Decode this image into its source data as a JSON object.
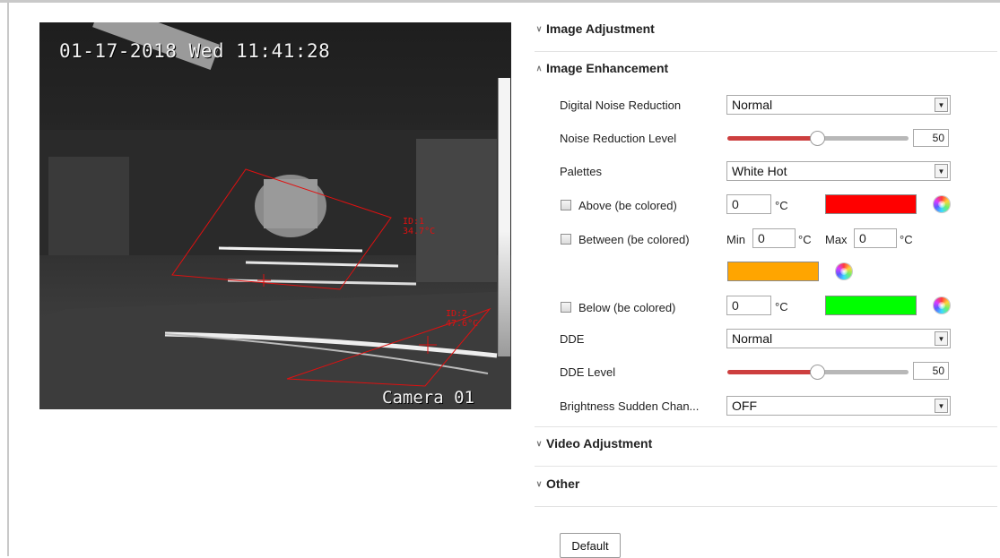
{
  "video": {
    "osd_time": "01-17-2018 Wed 11:41:28",
    "osd_camera": "Camera 01",
    "roi_1_label": "ID:1\n34.7°C",
    "roi_2_label": "ID:2\n47.6°C"
  },
  "sections": {
    "image_adjustment": "Image Adjustment",
    "image_enhancement": "Image Enhancement",
    "video_adjustment": "Video Adjustment",
    "other": "Other"
  },
  "settings": {
    "digital_noise_reduction": {
      "label": "Digital Noise Reduction",
      "value": "Normal"
    },
    "noise_reduction_level": {
      "label": "Noise Reduction Level",
      "value": "50",
      "fraction": 0.5
    },
    "palettes": {
      "label": "Palettes",
      "value": "White Hot"
    },
    "above": {
      "label": "Above (be colored)",
      "value": "0",
      "unit": "°C",
      "color": "#ff0000"
    },
    "between": {
      "label": "Between (be colored)",
      "min_label": "Min",
      "min_value": "0",
      "min_unit": "°C",
      "max_label": "Max",
      "max_value": "0",
      "max_unit": "°C",
      "color": "#ffa500"
    },
    "below": {
      "label": "Below (be colored)",
      "value": "0",
      "unit": "°C",
      "color": "#00ff00"
    },
    "dde": {
      "label": "DDE",
      "value": "Normal"
    },
    "dde_level": {
      "label": "DDE Level",
      "value": "50",
      "fraction": 0.5
    },
    "brightness_sudden_change": {
      "label": "Brightness Sudden Chan...",
      "value": "OFF"
    }
  },
  "buttons": {
    "default_label": "Default"
  },
  "colors": {
    "slider_fill": "#cd3f3f",
    "roi": "#e01010"
  }
}
